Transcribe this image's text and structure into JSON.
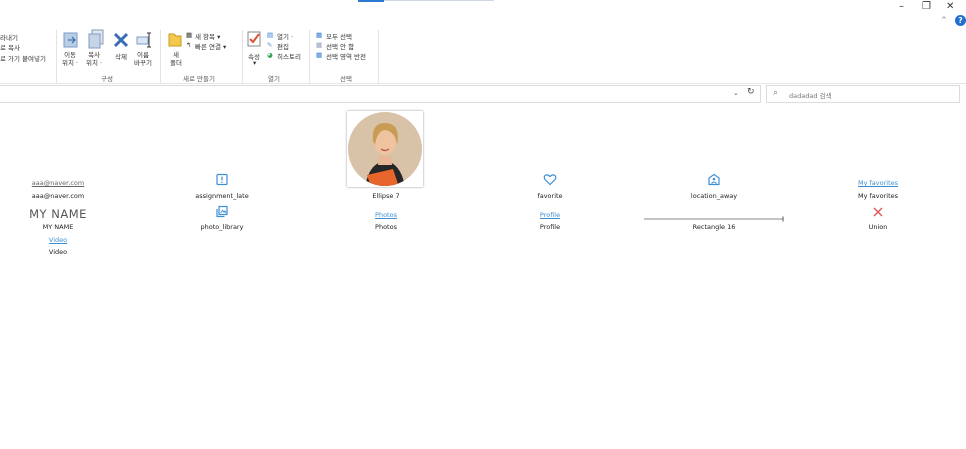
{
  "ribbon": {
    "clip_labels": [
      "라내기",
      "로 복사",
      "로 가기 붙여넣기"
    ],
    "move_to": "이동\n위치 ·",
    "copy_to": "복사\n위치 ·",
    "delete": "삭제",
    "rename": "이름\n바꾸기",
    "organize_group": "구성",
    "new_folder": "새\n폴더",
    "new_item": "새 항목 ▾",
    "easy_access": "빠른 연결 ▾",
    "new_group": "새로 만들기",
    "properties": "속성",
    "open": "열기 ·",
    "edit": "편집",
    "history": "히스토리",
    "open_group": "열기",
    "select_all": "모두 선택",
    "select_none": "선택 안 함",
    "invert_selection": "선택 영역 반전",
    "select_group": "선택"
  },
  "window": {
    "minimize": "–",
    "restore": "❐",
    "close": "✕",
    "help": "?"
  },
  "search": {
    "placeholder": "dadadad 검색"
  },
  "items": {
    "email_small": "aaa@naver.com",
    "email_label": "aaa@naver.com",
    "myname_big": "MY NAME",
    "myname_label": "MY NAME",
    "video_small": "Video",
    "video_label": "Video",
    "assignment_label": "assignment_late",
    "photo_library_label": "photo_library",
    "ellipse_label": "Ellipse 7",
    "photos_small": "Photos",
    "photos_label": "Photos",
    "favorite_label": "favorite",
    "profile_small": "Profile",
    "profile_label": "Profile",
    "location_label": "location_away",
    "rectangle_label": "Rectangle 16",
    "myfav_small": "My favorites",
    "myfav_label": "My favorites",
    "union_label": "Union"
  },
  "colors": {
    "accent": "#2b79d0",
    "link": "#3d8fd4",
    "union": "#e25656"
  }
}
